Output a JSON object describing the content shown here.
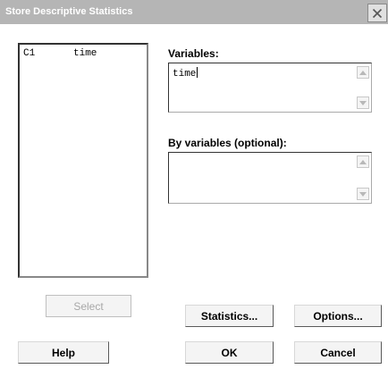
{
  "window": {
    "title": "Store Descriptive Statistics",
    "close_symbol": "×"
  },
  "columns_list": {
    "items": [
      {
        "column": "C1",
        "name": "time"
      }
    ]
  },
  "variables": {
    "label": "Variables:",
    "value": "time"
  },
  "by_variables": {
    "label": "By variables (optional):",
    "value": ""
  },
  "buttons": {
    "select": "Select",
    "statistics": "Statistics...",
    "options": "Options...",
    "help": "Help",
    "ok": "OK",
    "cancel": "Cancel"
  },
  "icons": {
    "close": "close-icon",
    "scroll_up": "chevron-up-icon",
    "scroll_down": "chevron-down-icon"
  },
  "colors": {
    "titlebar": "#b5b5b5",
    "disabled_text": "#a8a8a8"
  }
}
